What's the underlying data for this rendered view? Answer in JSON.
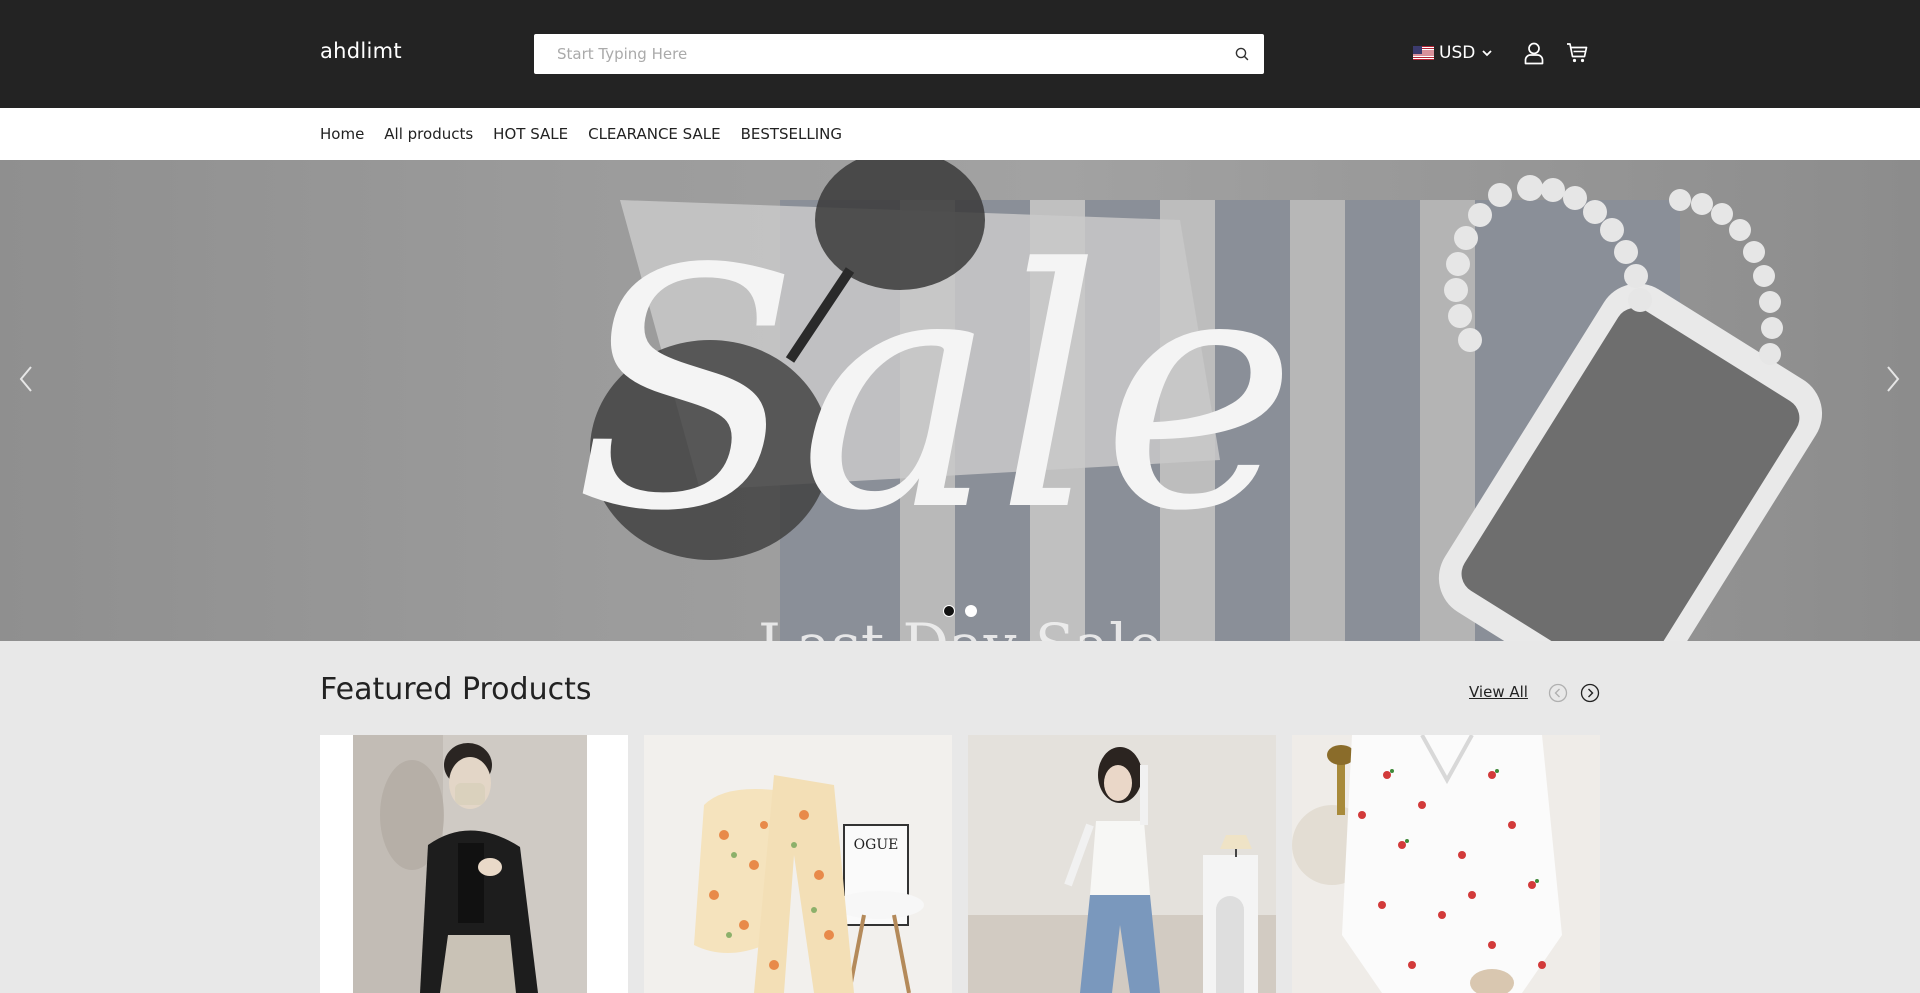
{
  "header": {
    "logo": "ahdlimt",
    "search_placeholder": "Start Typing Here",
    "currency": "USD",
    "icons": [
      "search-icon",
      "flag-us-icon",
      "chevron-down-icon",
      "user-icon",
      "cart-icon"
    ]
  },
  "nav": {
    "items": [
      {
        "label": "Home"
      },
      {
        "label": "All products"
      },
      {
        "label": "HOT SALE"
      },
      {
        "label": "CLEARANCE SALE"
      },
      {
        "label": "BESTSELLING"
      }
    ]
  },
  "hero": {
    "headline": "Sale",
    "subline": "Last Day Sale",
    "slides_total": 2,
    "active_slide": 1
  },
  "featured": {
    "title": "Featured Products",
    "view_all": "View All"
  },
  "colors": {
    "header_bg": "#232323",
    "page_bg": "#e8e8e8"
  }
}
